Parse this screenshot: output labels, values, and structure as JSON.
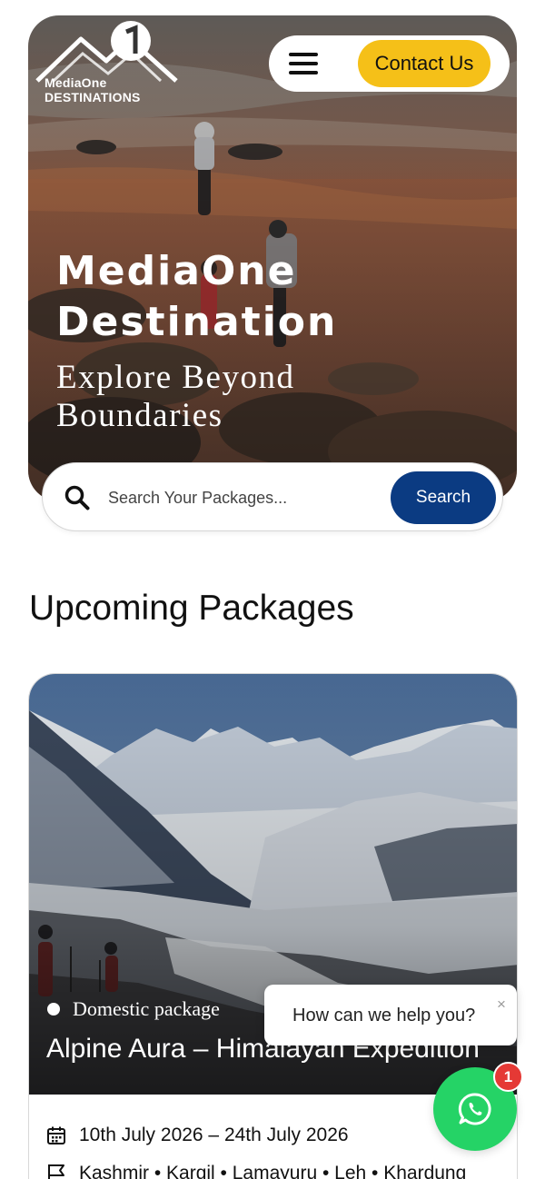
{
  "brand": {
    "logo_line1": "MediaOne",
    "logo_line2": "DESTINATIONS"
  },
  "nav": {
    "contact_label": "Contact Us"
  },
  "hero": {
    "title": "MediaOne Destination",
    "subtitle": "Explore Beyond Boundaries"
  },
  "search": {
    "placeholder": "Search Your Packages...",
    "button_label": "Search"
  },
  "section": {
    "title": "Upcoming Packages"
  },
  "packages": [
    {
      "category": "Domestic package",
      "title": "Alpine Aura – Himalayan Expedition",
      "dates": "10th July 2026 – 24th July 2026",
      "route": "Kashmir • Kargil • Lamayuru • Leh • Khardung"
    }
  ],
  "chat": {
    "prompt": "How can we help you?",
    "close_symbol": "×",
    "unread_count": "1"
  },
  "colors": {
    "accent_yellow": "#f5c018",
    "search_button": "#0b3b82",
    "whatsapp_green": "#25d366",
    "badge_red": "#e53935"
  }
}
